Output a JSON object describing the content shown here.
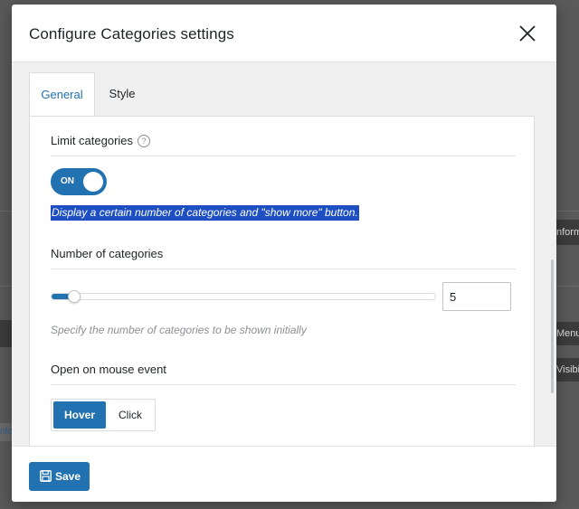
{
  "modal": {
    "title": "Configure Categories settings",
    "close_icon": "close-icon"
  },
  "tabs": [
    {
      "label": "General",
      "active": true
    },
    {
      "label": "Style",
      "active": false
    }
  ],
  "limit_categories": {
    "label": "Limit categories",
    "help_icon": "help-icon",
    "help_glyph": "?",
    "toggle_label": "ON",
    "toggle_state": true,
    "description": "Display a certain number of categories and \"show more\" button."
  },
  "number_of_categories": {
    "label": "Number of categories",
    "value": "5",
    "slider_fraction": 0.04,
    "hint": "Specify the number of categories to be shown initially"
  },
  "mouse_event": {
    "label": "Open on mouse event",
    "options": [
      "Hover",
      "Click"
    ],
    "selected": "Hover"
  },
  "footer": {
    "save_label": "Save",
    "save_icon": "floppy-disk-icon"
  },
  "background": {
    "frag_1": "nform",
    "frag_2": "Menu",
    "frag_3": "Visibi",
    "frag_4": "nfo"
  },
  "colors": {
    "accent": "#2271b1",
    "selection": "#1e4fc2",
    "overlay": "#5a5a5a"
  }
}
